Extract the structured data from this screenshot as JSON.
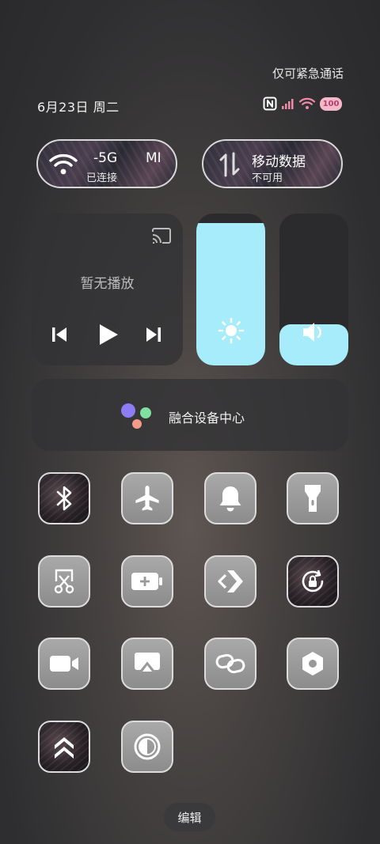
{
  "status_bar": {
    "emergency_text": "仅可紧急通话",
    "date_text": "6月23日 周二",
    "battery_level": "100",
    "icons": [
      "nfc-icon",
      "signal-icon",
      "wifi-icon",
      "battery-icon"
    ]
  },
  "wifi_pill": {
    "network": "-5G",
    "extra": "MI",
    "status": "已连接",
    "icon": "wifi-icon"
  },
  "mobile_pill": {
    "title": "移动数据",
    "status": "不可用",
    "icon": "data-arrows-icon"
  },
  "media": {
    "no_playback": "暂无播放",
    "icons": [
      "cast-icon",
      "previous-icon",
      "play-icon",
      "next-icon"
    ]
  },
  "brightness": {
    "level": 0.94,
    "icon": "sun-icon"
  },
  "volume": {
    "level": 0.27,
    "icon": "speaker-icon"
  },
  "fusion": {
    "label": "融合设备中心",
    "icon": "assistant-dots-icon"
  },
  "toggles": [
    {
      "name": "bluetooth",
      "active": true
    },
    {
      "name": "airplane",
      "active": false
    },
    {
      "name": "ringer",
      "active": false
    },
    {
      "name": "flashlight",
      "active": false
    },
    {
      "name": "screenshot",
      "active": false
    },
    {
      "name": "battery-saver",
      "active": false
    },
    {
      "name": "nearby-share",
      "active": false
    },
    {
      "name": "rotation-lock",
      "active": true
    },
    {
      "name": "screen-record",
      "active": false
    },
    {
      "name": "screen-cast",
      "active": false
    },
    {
      "name": "link",
      "active": false
    },
    {
      "name": "settings-hex",
      "active": false
    },
    {
      "name": "performance",
      "active": true
    },
    {
      "name": "dark-mode",
      "active": false
    }
  ],
  "edit_label": "编辑",
  "colors": {
    "slider_fill": "#a6ecfa",
    "battery_badge": "#f5b8c8",
    "status_pink": "#f08aa6"
  }
}
